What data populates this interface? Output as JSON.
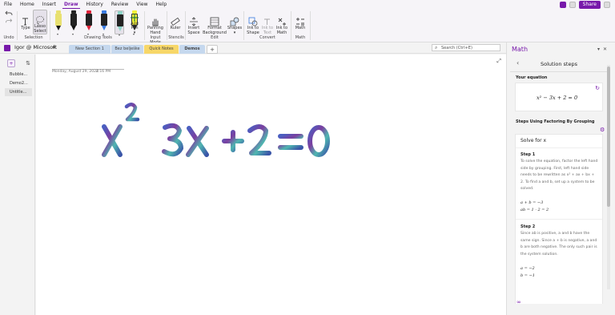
{
  "menu": {
    "items": [
      "File",
      "Home",
      "Insert",
      "Draw",
      "History",
      "Review",
      "View",
      "Help"
    ],
    "active": "Draw",
    "share_label": "Share"
  },
  "ribbon": {
    "undo_label": "Undo",
    "type_label": "Type",
    "lasso_label": "Lasso Select",
    "selection_label": "Selection",
    "drawing_tools_label": "Drawing Tools",
    "add_pen_label": "Add Pen",
    "panning_label": "Panning Hand",
    "input_mode_label": "Input Mode",
    "ruler_label": "Ruler",
    "stencils_label": "Stencils",
    "insert_space_label": "Insert Space",
    "format_bg_label": "Format Background",
    "shapes_label": "Shapes",
    "edit_label": "Edit",
    "ink_shape_label": "Ink to Shape",
    "ink_text_label": "Ink to Text",
    "ink_math_label": "Ink to Math",
    "convert_label": "Convert",
    "math_label": "Math",
    "math_group_label": "Math",
    "pens": [
      {
        "color": "#e8e070",
        "body": "#222"
      },
      {
        "color": "#222222",
        "body": "#222"
      },
      {
        "color": "#e0243b",
        "body": "#222"
      },
      {
        "color": "#3a7be0",
        "body": "#222"
      },
      {
        "color": "#8ed4c8",
        "body": "#222"
      },
      {
        "color": "#f5f238",
        "body": "#f5f238"
      }
    ]
  },
  "notebook": {
    "title": "Igor @ Microsoft",
    "tabs": [
      {
        "label": "New Section 1",
        "color": "#c5d8ee"
      },
      {
        "label": "Bez belješke",
        "color": "#c5d8ee"
      },
      {
        "label": "Quick Notes",
        "color": "#f7d768"
      },
      {
        "label": "Demos",
        "color": "#c5d8ee"
      }
    ],
    "add_tab": "+",
    "search_placeholder": "Search (Ctrl+E)"
  },
  "pages": [
    "Bubble...",
    "Demo2...",
    "Untitle..."
  ],
  "note": {
    "date": "Monday, August 29, 2022",
    "time": "4:16 PM",
    "ink_equation": "x² - 3x + 2 = 0"
  },
  "math": {
    "pane_title": "Math",
    "steps_title": "Solution steps",
    "your_equation_label": "Your equation",
    "equation": "x² − 3x + 2 = 0",
    "method_label": "Steps Using Factoring By Grouping",
    "solve_label": "Solve for x",
    "step1_label": "Step 1",
    "step1_text": "To solve the equation, factor the left hand side by grouping. First, left hand side needs to be rewritten as x² + ax + bx + 2. To find a and b, set up a system to be solved.",
    "step1_eq1": "a + b = −3",
    "step1_eq2": "ab = 1 · 2 = 2",
    "step2_label": "Step 2",
    "step2_text": "Since ab is positive, a and b have the same sign. Since a + b is negative, a and b are both negative. The only such pair is the system solution.",
    "step2_eq1": "a = −2",
    "step2_eq2": "b = −1"
  }
}
